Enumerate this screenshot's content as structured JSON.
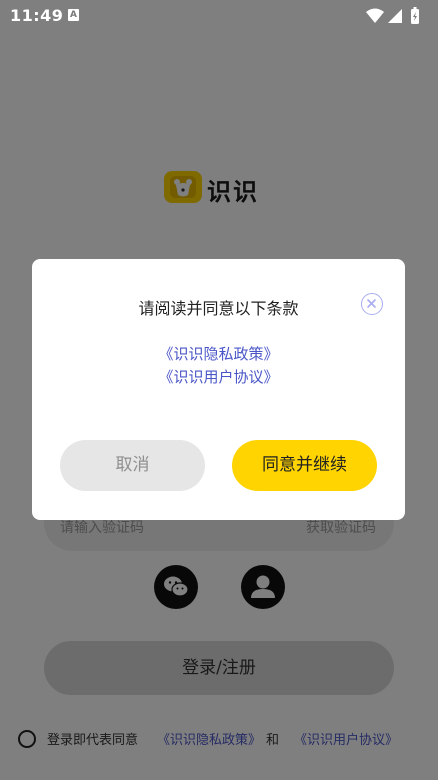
{
  "status_bar": {
    "time": "11:49",
    "notification_icon": "A",
    "icons": [
      "wifi-icon",
      "cellular-signal-icon",
      "battery-icon"
    ]
  },
  "app": {
    "logo_text": "识识"
  },
  "form": {
    "code_placeholder": "请输入验证码",
    "get_code_label": "获取验证码",
    "third_party_logins": [
      "wechat-icon",
      "account-icon"
    ],
    "login_button_label": "登录/注册"
  },
  "agreement": {
    "prefix": "登录即代表同意",
    "privacy_link": "《识识隐私政策》",
    "and": "和",
    "user_link": "《识识用户协议》"
  },
  "dialog": {
    "title": "请阅读并同意以下条款",
    "privacy_link": "《识识隐私政策》",
    "user_link": "《识识用户协议》",
    "cancel_label": "取消",
    "agree_label": "同意并继续"
  },
  "colors": {
    "accent": "#ffd400",
    "link": "#4a56c8",
    "overlay": "rgba(0,0,0,0.5)"
  }
}
